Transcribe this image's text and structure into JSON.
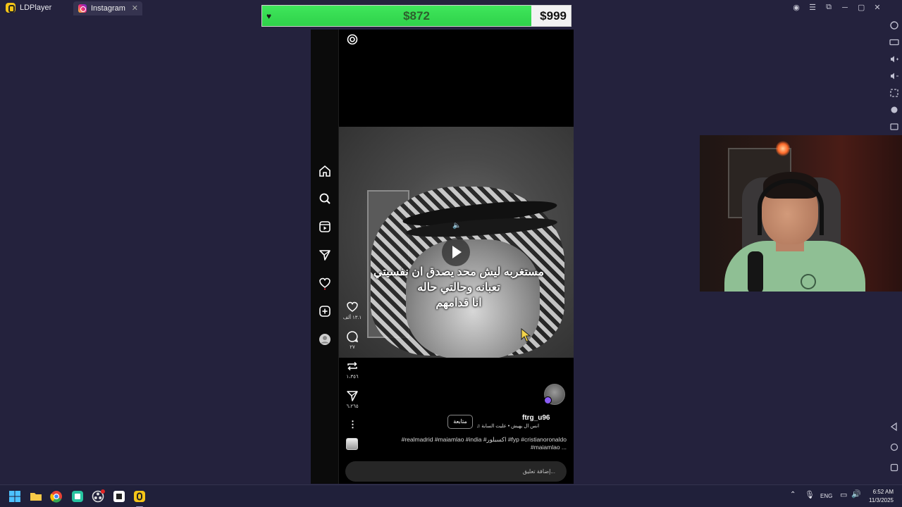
{
  "titlebar": {
    "app_name": "LDPlayer",
    "tab_label": "Instagram",
    "tab_close": "✕"
  },
  "goal": {
    "current": "$872",
    "target": "$999",
    "progress_fraction": 0.873,
    "fill_color": "#39e052"
  },
  "instagram": {
    "nav": [
      "home-icon",
      "search-icon",
      "reels-icon",
      "direct-icon",
      "heart-icon",
      "create-icon",
      "profile-icon"
    ],
    "caption_lines": [
      "مستغربه ليش محد يصدق ان نفسيتي",
      "تعبانه وحالتي حاله",
      "انا قدامهم"
    ],
    "likes": "١٣.١ ألف",
    "comments": "٢٧",
    "reposts": "١،٣٥٦",
    "shares": "٦،٢٦٥",
    "username": "ftrg_u96",
    "follow_label": "متابعة",
    "music": "انس ال يهيش • عليت السابة",
    "description": "#realmadrid #maiamlao #india #اكسبلور #fyp #cristianoronaldo #maiamlao ...",
    "comment_placeholder": "إضافة تعليق..."
  },
  "taskbar": {
    "lang": "ENG",
    "time": "6:52 AM",
    "date": "11/3/2025"
  }
}
